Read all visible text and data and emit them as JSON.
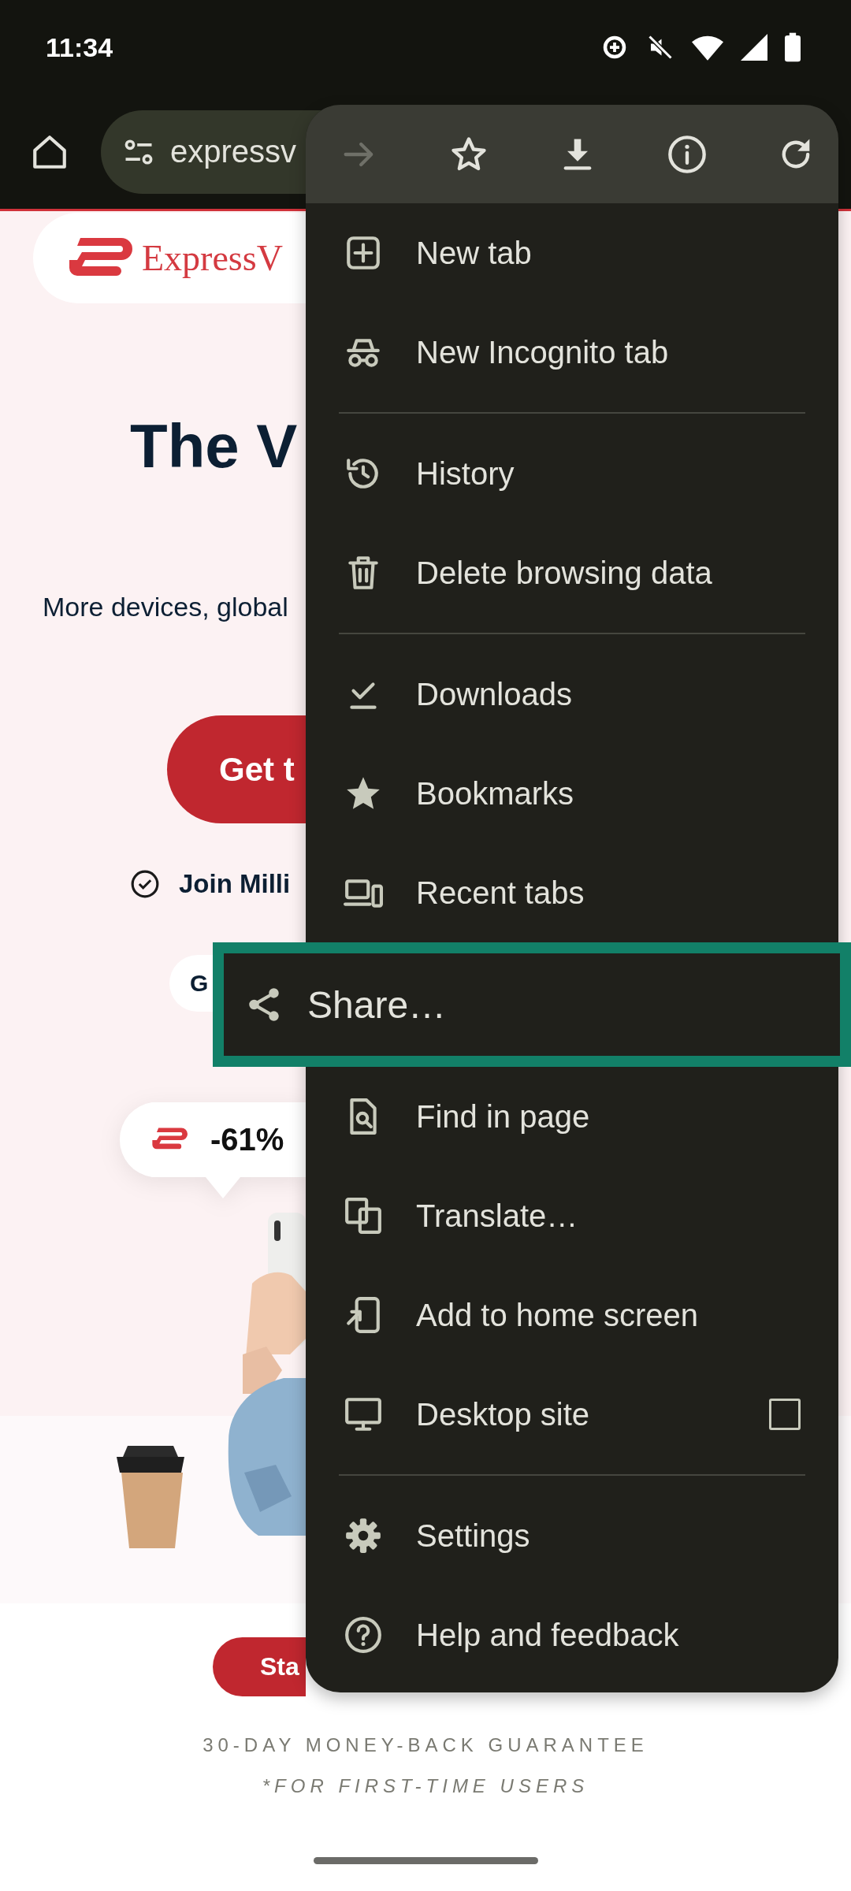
{
  "status_bar": {
    "time": "11:34"
  },
  "toolbar": {
    "url": "expressv"
  },
  "page": {
    "logo_text": "ExpressV",
    "heading": "The V",
    "subtitle": "More devices, global",
    "cta": "Get t",
    "join": "Join Milli",
    "chip": "G",
    "discount": "-61%",
    "bottom_button": "Sta",
    "guarantee": "30-DAY MONEY-BACK GUARANTEE",
    "footnote": "*FOR FIRST-TIME USERS"
  },
  "menu": {
    "actions": [
      {
        "kind": "forward",
        "disabled": true
      },
      {
        "kind": "star",
        "disabled": false
      },
      {
        "kind": "download",
        "disabled": false
      },
      {
        "kind": "info",
        "disabled": false
      },
      {
        "kind": "reload",
        "disabled": false
      }
    ],
    "sections": [
      {
        "items": [
          {
            "kind": "new-tab",
            "label": "New tab",
            "highlighted": false
          },
          {
            "kind": "incognito",
            "label": "New Incognito tab",
            "highlighted": false
          }
        ]
      },
      {
        "items": [
          {
            "kind": "history",
            "label": "History",
            "highlighted": false
          },
          {
            "kind": "delete",
            "label": "Delete browsing data",
            "highlighted": false
          }
        ]
      },
      {
        "items": [
          {
            "kind": "downloads",
            "label": "Downloads",
            "highlighted": false
          },
          {
            "kind": "bookmarks",
            "label": "Bookmarks",
            "highlighted": false
          },
          {
            "kind": "recent-tabs",
            "label": "Recent tabs",
            "highlighted": false
          },
          {
            "kind": "share",
            "label": "Share…",
            "highlighted": true
          },
          {
            "kind": "find",
            "label": "Find in page",
            "highlighted": false
          },
          {
            "kind": "translate",
            "label": "Translate…",
            "highlighted": false
          },
          {
            "kind": "add-home",
            "label": "Add to home screen",
            "highlighted": false
          },
          {
            "kind": "desktop",
            "label": "Desktop site",
            "highlighted": false,
            "checked": false
          }
        ]
      },
      {
        "items": [
          {
            "kind": "settings",
            "label": "Settings",
            "highlighted": false
          },
          {
            "kind": "help",
            "label": "Help and feedback",
            "highlighted": false
          }
        ]
      }
    ]
  }
}
